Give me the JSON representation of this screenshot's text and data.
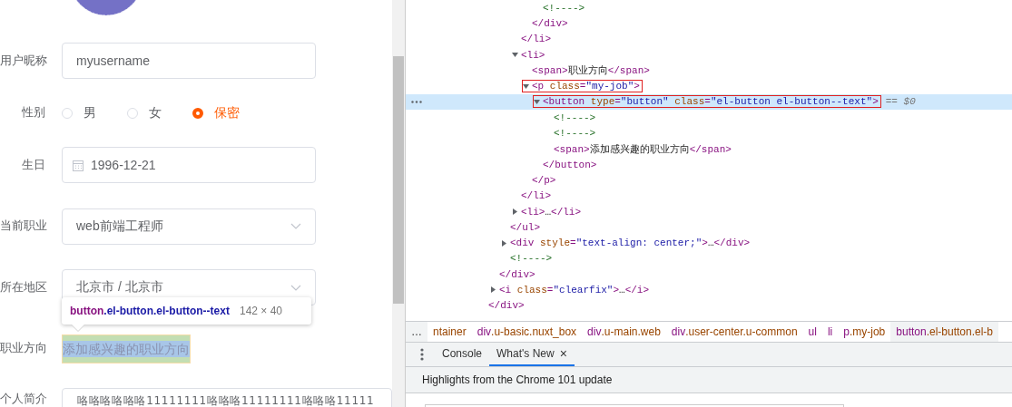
{
  "form": {
    "fields": [
      {
        "kind": "text",
        "label": "用户昵称",
        "value": "myusername"
      },
      {
        "kind": "radio",
        "label": "性别",
        "options": [
          {
            "label": "男",
            "selected": false
          },
          {
            "label": "女",
            "selected": false
          },
          {
            "label": "保密",
            "selected": true
          }
        ]
      },
      {
        "kind": "date",
        "label": "生日",
        "value": "1996-12-21"
      },
      {
        "kind": "select",
        "label": "当前职业",
        "value": "web前端工程师"
      },
      {
        "kind": "select",
        "label": "所在地区",
        "value": "北京市 / 北京市"
      },
      {
        "kind": "textbutton",
        "label": "职业方向",
        "value": "添加感兴趣的职业方向"
      },
      {
        "kind": "textarea",
        "label": "个人简介",
        "value": "咯咯咯咯咯咯11111111咯咯咯11111111咯咯咯11111"
      }
    ]
  },
  "inspect_tooltip": {
    "tag": "button",
    "classes": ".el-button.el-button--text",
    "size": "142 × 40"
  },
  "dom": [
    {
      "selected": false,
      "close": "</div>",
      "children": [
        {
          "selected": false,
          "close": "</div>",
          "children": [
            {
              "selected": false,
              "close": "</ul>",
              "children": [
                {
                  "selected": false,
                  "close": "</li>",
                  "children": [
                    {
                      "selected": false,
                      "close": "</div>",
                      "children": [
                        {
                          "selected": false,
                          "open": "<!---->"
                        }
                      ]
                    }
                  ]
                },
                {
                  "selected": false,
                  "open": "<li>",
                  "expanded": true,
                  "close": "</li>",
                  "children": [
                    {
                      "selected": false,
                      "open": "<span>职业方向</span>"
                    },
                    {
                      "selected": false,
                      "open": "<p class=\"my-job\">",
                      "expanded": true,
                      "annotated": true,
                      "close": "</p>",
                      "children": [
                        {
                          "selected": true,
                          "open": "<button type=\"button\" class=\"el-button el-button--text\">",
                          "suffix": "== $0",
                          "expanded": true,
                          "annotated": true,
                          "close": "</button>",
                          "children": [
                            {
                              "selected": false,
                              "open": "<!---->"
                            },
                            {
                              "selected": false,
                              "open": "<!---->"
                            },
                            {
                              "selected": false,
                              "open": "<span>添加感兴趣的职业方向</span>"
                            }
                          ]
                        }
                      ]
                    }
                  ]
                },
                {
                  "selected": false,
                  "open": "<li>…</li>",
                  "expanded": false
                }
              ]
            },
            {
              "selected": false,
              "open": "<div style=\"text-align: center;\">…</div>",
              "expanded": false
            },
            {
              "selected": false,
              "open": "<!---->"
            }
          ]
        },
        {
          "selected": false,
          "open": "<i class=\"clearfix\">…</i>",
          "expanded": false
        }
      ]
    }
  ],
  "breadcrumbs": [
    {
      "classes": "ntainer",
      "selected": false
    },
    {
      "tag": "div",
      "classes": ".u-basic.nuxt_box",
      "selected": false
    },
    {
      "tag": "div",
      "classes": ".u-main.web",
      "selected": false
    },
    {
      "tag": "div",
      "classes": ".user-center.u-common",
      "selected": false
    },
    {
      "tag": "ul",
      "selected": false
    },
    {
      "tag": "li",
      "selected": false
    },
    {
      "tag": "p",
      "classes": ".my-job",
      "selected": false
    },
    {
      "tag": "button",
      "classes": ".el-button.el-b",
      "selected": true
    }
  ],
  "drawer_tabs": [
    {
      "label": "Console",
      "selected": false,
      "closable": false
    },
    {
      "label": "What's New",
      "selected": true,
      "closable": true
    }
  ],
  "close_glyph": "×",
  "more_glyph": "…",
  "whats_new": {
    "heading": "Highlights from the Chrome 101 update"
  }
}
